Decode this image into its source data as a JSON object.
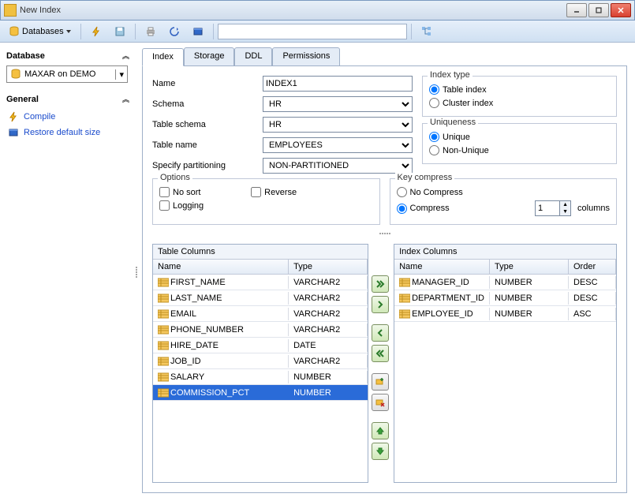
{
  "window": {
    "title": "New Index"
  },
  "toolbar": {
    "databases_label": "Databases"
  },
  "side": {
    "database_hdr": "Database",
    "db_selected": "MAXAR on DEMO",
    "general_hdr": "General",
    "compile_label": "Compile",
    "restore_label": "Restore default size"
  },
  "tabs": {
    "index": "Index",
    "storage": "Storage",
    "ddl": "DDL",
    "permissions": "Permissions"
  },
  "form": {
    "name_lbl": "Name",
    "name_val": "INDEX1",
    "schema_lbl": "Schema",
    "schema_val": "HR",
    "tblschema_lbl": "Table schema",
    "tblschema_val": "HR",
    "tblname_lbl": "Table name",
    "tblname_val": "EMPLOYEES",
    "part_lbl": "Specify partitioning",
    "part_val": "NON-PARTITIONED"
  },
  "options": {
    "legend": "Options",
    "nosort": "No sort",
    "reverse": "Reverse",
    "logging": "Logging"
  },
  "indextype": {
    "legend": "Index type",
    "table": "Table index",
    "cluster": "Cluster index"
  },
  "uniqueness": {
    "legend": "Uniqueness",
    "unique": "Unique",
    "nonunique": "Non-Unique"
  },
  "keycompress": {
    "legend": "Key compress",
    "no": "No Compress",
    "yes": "Compress",
    "spin_val": "1",
    "columns_lbl": "columns"
  },
  "tablecols": {
    "hdr": "Table Columns",
    "name": "Name",
    "type": "Type",
    "rows": [
      {
        "name": "FIRST_NAME",
        "type": "VARCHAR2"
      },
      {
        "name": "LAST_NAME",
        "type": "VARCHAR2"
      },
      {
        "name": "EMAIL",
        "type": "VARCHAR2"
      },
      {
        "name": "PHONE_NUMBER",
        "type": "VARCHAR2"
      },
      {
        "name": "HIRE_DATE",
        "type": "DATE"
      },
      {
        "name": "JOB_ID",
        "type": "VARCHAR2"
      },
      {
        "name": "SALARY",
        "type": "NUMBER"
      },
      {
        "name": "COMMISSION_PCT",
        "type": "NUMBER"
      }
    ],
    "selected": 7
  },
  "indexcols": {
    "hdr": "Index Columns",
    "name": "Name",
    "type": "Type",
    "order": "Order",
    "rows": [
      {
        "name": "MANAGER_ID",
        "type": "NUMBER",
        "order": "DESC"
      },
      {
        "name": "DEPARTMENT_ID",
        "type": "NUMBER",
        "order": "DESC"
      },
      {
        "name": "EMPLOYEE_ID",
        "type": "NUMBER",
        "order": "ASC"
      }
    ]
  }
}
